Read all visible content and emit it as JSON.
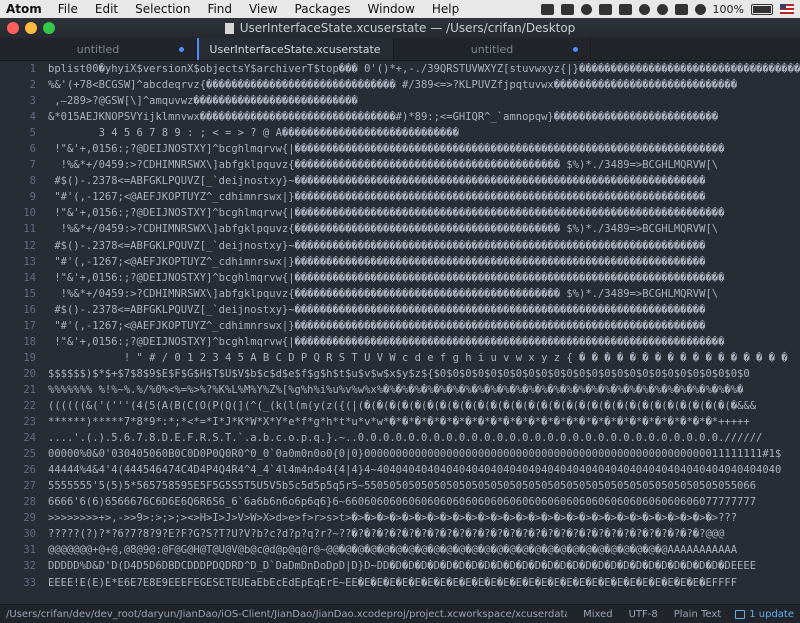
{
  "menubar": {
    "app": "Atom",
    "items": [
      "File",
      "Edit",
      "Selection",
      "Find",
      "View",
      "Packages",
      "Window",
      "Help"
    ],
    "battery": "100%"
  },
  "window": {
    "title": "UserInterfaceState.xcuserstate — /Users/crifan/Desktop"
  },
  "tabs": [
    {
      "label": "untitled",
      "modified": true,
      "active": false
    },
    {
      "label": "UserInterfaceState.xcuserstate",
      "modified": false,
      "active": true
    },
    {
      "label": "untitled",
      "modified": true,
      "active": false
    }
  ],
  "editor": {
    "lines": [
      {
        "n": "1",
        "text": "bplist00�yhyiX$versionX$objectsY$archiverT$top��� 0'()*+,-./39QRSTUVWXYZ[stuvwxyz{|}�������������������������������������"
      },
      {
        "n": "2",
        "text": "%&'(+78<BCGSW]^abcdeqrvz{������������������������������ #/389<=>?KLPUVZfjpqtuvwx�����������������������������"
      },
      {
        "n": "3",
        "text": " ,–289>?@GSW[\\]^amquvwz��������������������������"
      },
      {
        "n": "4",
        "text": "&*015AEJKNOPSVYijklmnvwx�������������������������������#)*89:;<=GHIQR^_`amnopqw}��������������������������"
      },
      {
        "n": "5",
        "text": "        3 4 5 6 7 8 9 : ; < = > ? @ A����������������������������"
      },
      {
        "n": "6",
        "text": " !\"&'+,0156:;?@DEIJNOSTXY]^bcghlmqrvw{|��������������������������������������������������������������������"
      },
      {
        "n": "7",
        "text": "  !%&*+/0459:>?CDHIMNRSWX\\]abfgklpquvz{������������������������������������������ $%)*./3489=>BCGHLMQRVW[\\"
      },
      {
        "n": "8",
        "text": " #$()-.2378<=ABFGKLPQUVZ[_`deijnostxy}~�����������������������������������������������������������������"
      },
      {
        "n": "9",
        "text": " \"#'(,-1267;<@AEFJKOPTUYZ^_cdhimnrswx|}�����������������������������������������������������������������"
      },
      {
        "n": "10",
        "text": " !\"&'+,0156:;?@DEIJNOSTXY]^bcghlmqrvw{|��������������������������������������������������������������������"
      },
      {
        "n": "11",
        "text": "  !%&*+/0459:>?CDHIMNRSWX\\]abfgklpquvz{������������������������������������������ $%)*./3489=>BCGHLMQRVW[\\"
      },
      {
        "n": "12",
        "text": " #$()-.2378<=ABFGKLPQUVZ[_`deijnostxy}~�����������������������������������������������������������������"
      },
      {
        "n": "13",
        "text": " \"#'(,-1267;<@AEFJKOPTUYZ^_cdhimnrswx|}�����������������������������������������������������������������"
      },
      {
        "n": "14",
        "text": " !\"&'+,0156:;?@DEIJNOSTXY]^bcghlmqrvw{|��������������������������������������������������������������������"
      },
      {
        "n": "15",
        "text": "  !%&*+/0459:>?CDHIMNRSWX\\]abfgklpquvz{������������������������������������������ $%)*./3489=>BCGHLMQRVW[\\"
      },
      {
        "n": "16",
        "text": " #$()-.2378<=ABFGKLPQUVZ[_`deijnostxy}~�����������������������������������������������������������������"
      },
      {
        "n": "17",
        "text": " \"#'(,-1267;<@AEFJKOPTUYZ^_cdhimnrswx|}�����������������������������������������������������������������"
      },
      {
        "n": "18",
        "text": " !\"&'+,0156:;?@DEIJNOSTXY]^bcghlmqrvw{|��������������������������������������������������������������������"
      },
      {
        "n": "19",
        "text": "            ! \" # / 0 1 2 3 4 5 A B C D P Q R S T U V W c d e f g h i u v w x y z { � � � � � � � � � � � � � � � � �"
      },
      {
        "n": "20",
        "text": "$$$$$$)$*$+$7$8$9$E$F$G$H$T$U$V$b$c$d$e$f$g$h$t$u$v$w$x$y$z${$0$0$0$0$0$0$0$0$0$0$0$0$0$0$0$0$0$0$0$0$0$0$0$0$0"
      },
      {
        "n": "21",
        "text": "%%%%%%% %!%~%.%/%0%<%=%>%?%K%L%M%Y%Z%[%g%h%i%u%v%w%x%�%�%�%�%�%�%�%�%�%�%�%�%�%�%�%�%�%�%�%�%�%�%�%�%�%�%�%�%�"
      },
      {
        "n": "22",
        "text": "((((((&('('''(4(5(A(B(C(O(P(Q(](^(_(k(l(m(y(z({(|(�(�(�(�(�(�(�(�(�(�(�(�(�(�(�(�(�(�(�(�(�(�(�(�(�(�(�(�(�(�&&&"
      },
      {
        "n": "23",
        "text": "******)*****7*8*9*:*;*<*=*I*J*K*W*X*Y*e*f*g*h*t*u*v*w*�*�*�*�*�*�*�*�*�*�*�*�*�*�*�*�*�*�*�*�*�*�*�*�*�*�*+++++"
      },
      {
        "n": "24",
        "text": "....'.(.).5.6.7.8.D.E.F.R.S.T.`.a.b.c.o.p.q.}.~..0.0.0.0.0.0.0.0.0.0.0.0.0.0.0.0.0.0.0.0.0.0.0.0.0.0.0.0.0.//////"
      },
      {
        "n": "25",
        "text": "00000%0&0'030405060B0C0D0P0Q0R0^0_0`0a0m0n0o0{0|0}000000000000000000000000000000000000000000000000000000011111111#1$"
      },
      {
        "n": "26",
        "text": "44444%4&4'4(444546474C4D4P4Q4R4^4_4`4l4m4n4o4{4|4}4~4040404040404040404040404040404040404040404040404040404040404040"
      },
      {
        "n": "27",
        "text": "5555555'5(5)5*565758595E5F5G5S5T5U5V5b5c5d5p5q5r5~55050505050505050505050505050505050505050505050505050505055066"
      },
      {
        "n": "28",
        "text": "6666'6(6)6566676C6D6E6Q6R6S6_6`6a6b6n6o6p6q6}6~66060606060606060606060606060606060606060606060606060606077777777"
      },
      {
        "n": "29",
        "text": ">>>>>>>>+>,->>9>:>;>;><>H>I>J>V>W>X>d>e>f>r>s>t>�>�>�>�>�>�>�>�>�>�>�>�>�>�>�>�>�>�>�>�>�>�>�>�>�>�>�>�>�>???"
      },
      {
        "n": "30",
        "text": "?????(?)?*?6?7?8?9?E?F?G?S?T?U?V?b?c?d?p?q?r?~??�?�?�?�?�?�?�?�?�?�?�?�?�?�?�?�?�?�?�?�?�?�?�?�?�?�?�?�?@@@"
      },
      {
        "n": "31",
        "text": "@@@@@@@+@+@,@8@9@:@F@G@H@T@U@V@b@c@d@p@q@r@~@@�@�@�@�@�@�@�@�@�@�@�@�@�@�@�@�@�@�@�@�@�@�@�@�@�@�@AAAAAAAAAAA"
      },
      {
        "n": "32",
        "text": "DDDDD%D&D'D(D4D5D6DBDCDDDPDQDRD^D_D`DaDmDnDoDpD|D}D~DD�D�D�D�D�D�D�D�D�D�D�D�D�D�D�D�D�D�D�D�D�D�D�D�D�D�D�DEEEE"
      },
      {
        "n": "33",
        "text": "EEEE!E(E)E*E6E7E8E9EEEFEGESETEUEaEbEcEdEpEqErE~EE�E�E�E�E�E�E�E�E�E�E�E�E�E�E�E�E�E�E�E�E�E�E�E�E�E�E�E�EFFFF"
      }
    ]
  },
  "statusbar": {
    "path": "/Users/crifan/dev/dev_root/daryun/JianDao/iOS-Client/JianDao/JianDao.xcodeproj/project.xcworkspace/xcuserdata/crifan.xcuserdatad/Us",
    "line_ending": "Mixed",
    "encoding": "UTF-8",
    "grammar": "Plain Text",
    "update": "1 update"
  }
}
